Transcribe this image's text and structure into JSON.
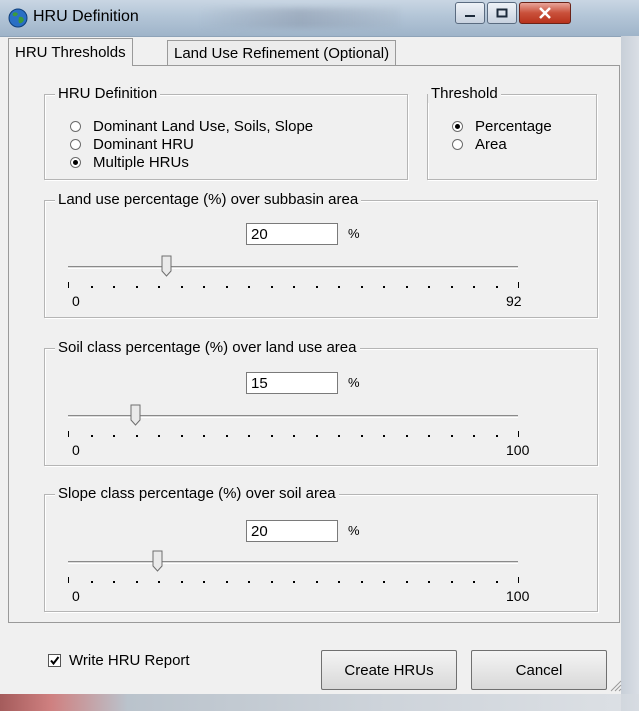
{
  "window": {
    "title": "HRU Definition",
    "minimize_label": "–",
    "maximize_label": "□",
    "close_label": "X"
  },
  "tabs": [
    {
      "label": "HRU Thresholds",
      "active": true
    },
    {
      "label": "Land Use Refinement (Optional)",
      "active": false
    }
  ],
  "hru_definition": {
    "title": "HRU Definition",
    "options": [
      {
        "label": "Dominant Land Use, Soils, Slope",
        "checked": false
      },
      {
        "label": "Dominant HRU",
        "checked": false
      },
      {
        "label": "Multiple HRUs",
        "checked": true
      }
    ]
  },
  "threshold": {
    "title": "Threshold",
    "options": [
      {
        "label": "Percentage",
        "checked": true
      },
      {
        "label": "Area",
        "checked": false
      }
    ]
  },
  "sliders": [
    {
      "title": "Land use percentage (%) over subbasin area",
      "value": "20",
      "unit": "%",
      "min": "0",
      "max": "92",
      "level": 0.22
    },
    {
      "title": "Soil class percentage (%) over land use area",
      "value": "15",
      "unit": "%",
      "min": "0",
      "max": "100",
      "level": 0.15
    },
    {
      "title": "Slope class percentage (%) over soil area",
      "value": "20",
      "unit": "%",
      "min": "0",
      "max": "100",
      "level": 0.2
    }
  ],
  "footer": {
    "write_report_label": "Write HRU Report",
    "write_report_checked": true,
    "create_label": "Create HRUs",
    "cancel_label": "Cancel"
  }
}
